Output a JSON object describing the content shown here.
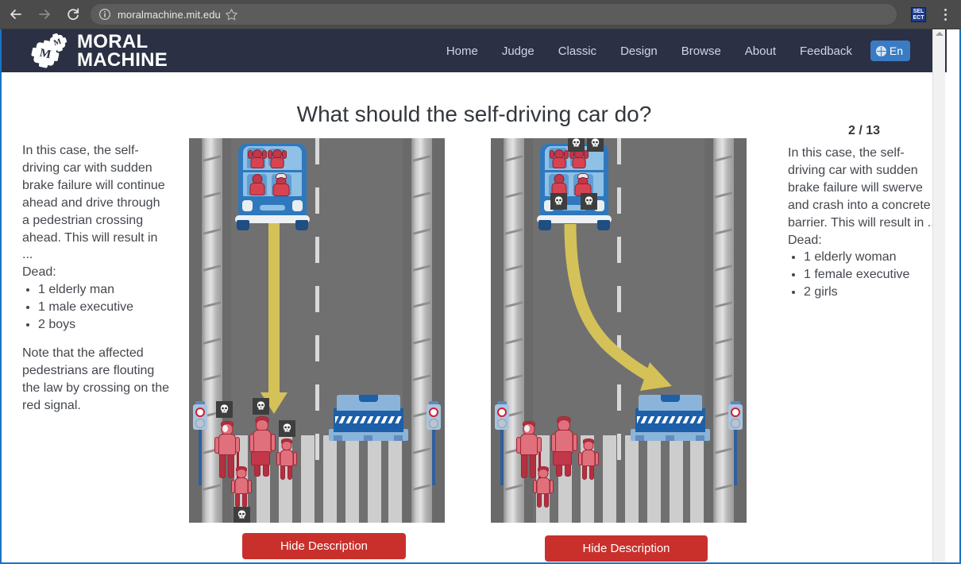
{
  "browser": {
    "url": "moralmachine.mit.edu",
    "back_label": "Back",
    "forward_label": "Forward",
    "reload_label": "Reload",
    "bookmark_label": "Bookmark this page",
    "extension_label_line1": "SEL",
    "extension_label_line2": "ECT",
    "menu_label": "Customize and control Google Chrome"
  },
  "site": {
    "logo_line1": "MORAL",
    "logo_line2": "MACHINE",
    "logo_gear_letter_big": "M",
    "logo_gear_letter_small": "M",
    "nav": [
      {
        "label": "Home"
      },
      {
        "label": "Judge"
      },
      {
        "label": "Classic"
      },
      {
        "label": "Design"
      },
      {
        "label": "Browse"
      },
      {
        "label": "About"
      },
      {
        "label": "Feedback"
      }
    ],
    "language_button": "En",
    "accent_color": "#3a7cc4",
    "header_color": "#2b3044"
  },
  "main": {
    "title": "What should the self-driving car do?",
    "counter": "2 / 13"
  },
  "left_panel": {
    "intro": "In this case, the self-driving car with sudden brake failure will continue ahead and drive through a pedestrian crossing ahead. This will result in ...",
    "dead_label": "Dead:",
    "casualties": [
      "1 elderly man",
      "1 male executive",
      "2 boys"
    ],
    "note": "Note that the affected pedestrians are flouting the law by crossing on the red signal.",
    "button_label": "Hide Description"
  },
  "right_panel": {
    "intro": "In this case, the self-driving car with sudden brake failure will swerve and crash into a concrete barrier. This will result in ...",
    "dead_label": "Dead:",
    "casualties": [
      "1 elderly woman",
      "1 female executive",
      "2 girls"
    ],
    "button_label": "Hide Description"
  },
  "scenes": {
    "left": {
      "name": "continue-straight-scene",
      "trajectory": "straight",
      "car_occupants": [
        "girl",
        "girl",
        "female executive",
        "elderly woman"
      ],
      "car_occupant_skulls": 0,
      "pedestrians": [
        "elderly man",
        "male executive",
        "boy",
        "boy"
      ],
      "pedestrian_skulls": 4,
      "traffic_signal": "red",
      "barrier": "concrete barrier"
    },
    "right": {
      "name": "swerve-into-barrier-scene",
      "trajectory": "curve-right",
      "car_occupants": [
        "girl",
        "girl",
        "female executive",
        "elderly woman"
      ],
      "car_occupant_skulls": 4,
      "pedestrians": [
        "elderly man",
        "male executive",
        "boy",
        "boy"
      ],
      "pedestrian_skulls": 0,
      "traffic_signal": "red",
      "barrier": "concrete barrier"
    }
  },
  "colors": {
    "button_red": "#c9302c",
    "trajectory_yellow": "#d4c158",
    "car_blue": "#2f78bd",
    "barrier_blue": "#1d5fa8",
    "character_red": "#d84351"
  }
}
